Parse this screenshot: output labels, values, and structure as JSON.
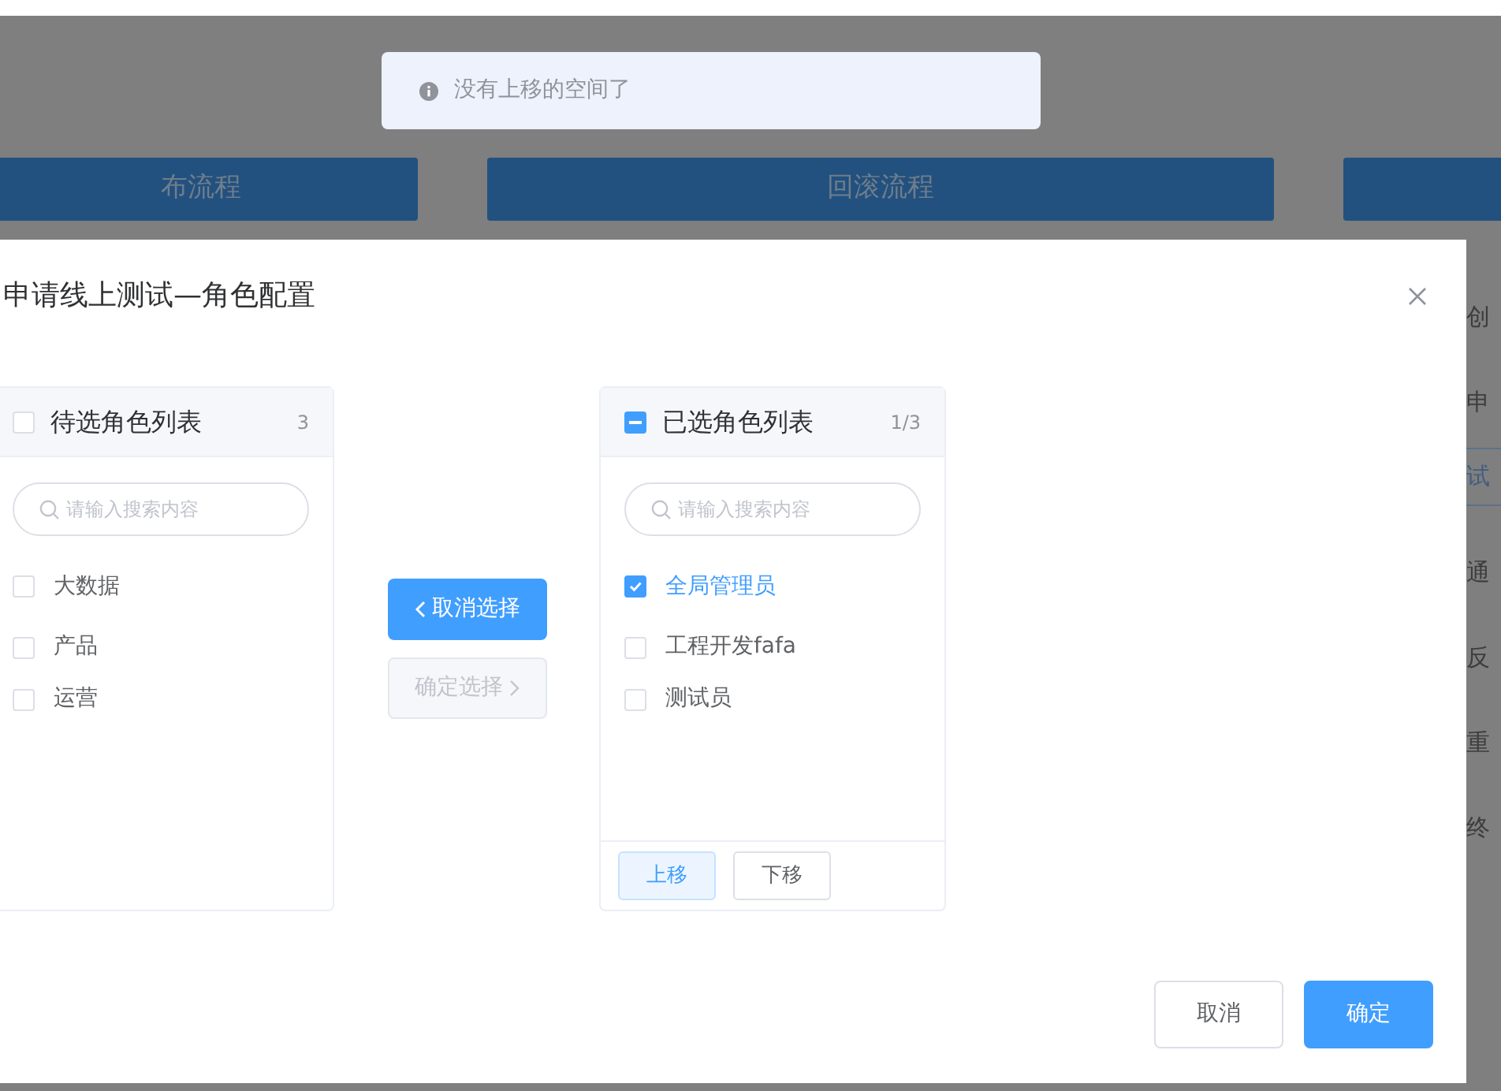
{
  "background": {
    "action_buttons": [
      {
        "label": "布流程"
      },
      {
        "label": "回滚流程"
      }
    ],
    "side_labels": [
      {
        "text": "创",
        "kind": "text"
      },
      {
        "text": "申",
        "kind": "text"
      },
      {
        "text": "试",
        "kind": "tag"
      },
      {
        "text": "通",
        "kind": "text"
      },
      {
        "text": "反",
        "kind": "text"
      },
      {
        "text": "重",
        "kind": "text"
      },
      {
        "text": "终",
        "kind": "text"
      }
    ]
  },
  "message": {
    "text": "没有上移的空间了"
  },
  "dialog": {
    "title": "申请线上测试—角色配置",
    "source": {
      "title": "待选角色列表",
      "count": "3",
      "indeterminate": false,
      "placeholder": "请输入搜索内容",
      "items": [
        {
          "label": "大数据",
          "checked": false
        },
        {
          "label": "产品",
          "checked": false
        },
        {
          "label": "运营",
          "checked": false
        }
      ]
    },
    "transfer_buttons": [
      {
        "label": "取消选择",
        "disabled": false
      },
      {
        "label": "确定选择",
        "disabled": true
      }
    ],
    "target": {
      "title": "已选角色列表",
      "count": "1/3",
      "indeterminate": true,
      "placeholder": "请输入搜索内容",
      "items": [
        {
          "label": "全局管理员",
          "checked": true
        },
        {
          "label": "工程开发fafa",
          "checked": false
        },
        {
          "label": "测试员",
          "checked": false
        }
      ],
      "footer_buttons": [
        {
          "label": "上移",
          "focused": true
        },
        {
          "label": "下移",
          "focused": false
        }
      ]
    },
    "footer_buttons": [
      {
        "label": "取消",
        "kind": "default"
      },
      {
        "label": "确定",
        "kind": "primary"
      }
    ]
  }
}
